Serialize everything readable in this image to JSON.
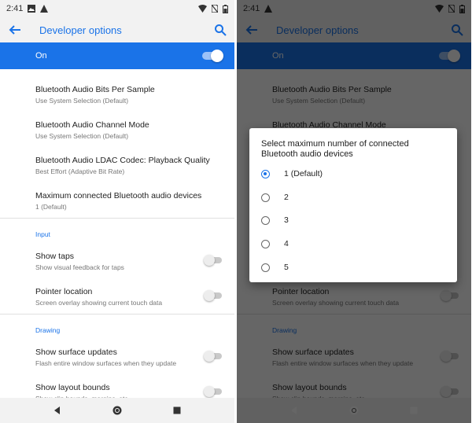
{
  "status_time": "2:41",
  "header": {
    "title": "Developer options"
  },
  "master_switch": {
    "label": "On",
    "state": "on"
  },
  "settings": [
    {
      "title": "Bluetooth Audio Bits Per Sample",
      "summary": "Use System Selection (Default)"
    },
    {
      "title": "Bluetooth Audio Channel Mode",
      "summary": "Use System Selection (Default)"
    },
    {
      "title": "Bluetooth Audio LDAC Codec: Playback Quality",
      "summary": "Best Effort (Adaptive Bit Rate)"
    },
    {
      "title": "Maximum connected Bluetooth audio devices",
      "summary": "1 (Default)"
    }
  ],
  "sections": {
    "input": "Input",
    "drawing": "Drawing"
  },
  "input_items": [
    {
      "title": "Show taps",
      "summary": "Show visual feedback for taps"
    },
    {
      "title": "Pointer location",
      "summary": "Screen overlay showing current touch data"
    }
  ],
  "drawing_items": [
    {
      "title": "Show surface updates",
      "summary": "Flash entire window surfaces when they update"
    },
    {
      "title": "Show layout bounds",
      "summary": "Show clip bounds, margins, etc."
    }
  ],
  "dialog": {
    "title": "Select maximum number of connected Bluetooth audio devices",
    "options": [
      "1 (Default)",
      "2",
      "3",
      "4",
      "5"
    ],
    "selected": "1 (Default)"
  },
  "colors": {
    "accent": "#1a73e8"
  },
  "icons": {
    "status_left": [
      "image-icon",
      "warning-icon"
    ],
    "status_right": [
      "wifi-icon",
      "no-sim-icon",
      "battery-icon"
    ],
    "navigation": [
      "back-triangle-icon",
      "home-circle-icon",
      "recents-square-icon"
    ]
  }
}
